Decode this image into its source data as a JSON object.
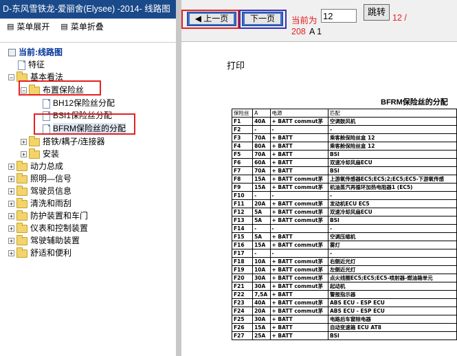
{
  "window": {
    "title": "D-东风雪铁龙-爱丽舍(Elysee)    -2014- 线路图"
  },
  "menu": {
    "expand": "菜单展开",
    "collapse": "菜单折叠"
  },
  "tree": {
    "current": "当前:线路图",
    "nodes": [
      {
        "label": "特征"
      },
      {
        "label": "基本看法"
      },
      {
        "label": "布置保险丝"
      },
      {
        "label": "BH12保险丝分配"
      },
      {
        "label": "BSI1保险丝分配"
      },
      {
        "label": "BFRM保险丝的分配"
      },
      {
        "label": "搭铁/耦子/连接器"
      },
      {
        "label": "安装"
      },
      {
        "label": "动力总成"
      },
      {
        "label": "照明—信号"
      },
      {
        "label": "驾驶员信息"
      },
      {
        "label": "清洗和雨刮"
      },
      {
        "label": "防护装置和车门"
      },
      {
        "label": "仪表和控制装置"
      },
      {
        "label": "驾驶辅助装置"
      },
      {
        "label": "舒适和便利"
      }
    ]
  },
  "nav": {
    "prev": "上一页",
    "next": "下一页",
    "current_label": "当前为",
    "page_value": "12",
    "jump": "跳转",
    "total_a": "12 /",
    "total_b": "208",
    "ab": "A 1",
    "accent": "#e32020"
  },
  "doc": {
    "print": "打印",
    "title": "BFRM保险丝的分配",
    "headers": [
      "保险丝",
      "A",
      "电源",
      "匹配"
    ],
    "rows": [
      [
        "F1",
        "40A",
        "+ BATT commut茅",
        "空调鼓风机"
      ],
      [
        "F2",
        "-",
        "-",
        "-"
      ],
      [
        "F3",
        "70A",
        "+ BATT",
        "乘客舱保险丝盒 12"
      ],
      [
        "F4",
        "80A",
        "+ BATT",
        "乘客舱保险丝盒 12"
      ],
      [
        "F5",
        "70A",
        "+ BATT",
        "BSI"
      ],
      [
        "F6",
        "60A",
        "+ BATT",
        "双速冷却风扇ECU"
      ],
      [
        "F7",
        "70A",
        "+ BATT",
        "BSI"
      ],
      [
        "F8",
        "15A",
        "+ BATT commut茅",
        "上游氧传感器EC5;EC5;2;EC5;EC5-下游氧传感"
      ],
      [
        "F9",
        "15A",
        "+ BATT commut茅",
        "机油蒸汽再循环加热电阻器1 (EC5)"
      ],
      [
        "F10",
        "-",
        "-",
        "-"
      ],
      [
        "F11",
        "20A",
        "+ BATT commut茅",
        "发动机ECU EC5"
      ],
      [
        "F12",
        "5A",
        "+ BATT commut茅",
        "双速冷却风扇ECU"
      ],
      [
        "F13",
        "5A",
        "+ BATT commut茅",
        "BSI"
      ],
      [
        "F14",
        "-",
        "-",
        "-"
      ],
      [
        "F15",
        "5A",
        "+ BATT",
        "空调压缩机"
      ],
      [
        "F16",
        "15A",
        "+ BATT commut茅",
        "雾灯"
      ],
      [
        "F17",
        "-",
        "-",
        "-"
      ],
      [
        "F18",
        "10A",
        "+ BATT commut茅",
        "右侧近光灯"
      ],
      [
        "F19",
        "10A",
        "+ BATT commut茅",
        "左侧近光灯"
      ],
      [
        "F20",
        "30A",
        "+ BATT commut茅",
        "点火线圈EC5;EC5;EC5-喷射器-燃油箱单元"
      ],
      [
        "F21",
        "30A",
        "+ BATT commut茅",
        "起动机"
      ],
      [
        "F22",
        "7,5A",
        "+ BATT",
        "警报指示器"
      ],
      [
        "F23",
        "40A",
        "+ BATT commut茅",
        "ABS ECU - ESP ECU"
      ],
      [
        "F24",
        "20A",
        "+ BATT commut茅",
        "ABS ECU - ESP ECU"
      ],
      [
        "F25",
        "30A",
        "+ BATT",
        "电路后车窗除电器"
      ],
      [
        "F26",
        "15A",
        "+ BATT",
        "自动变速箱 ECU AT8"
      ],
      [
        "F27",
        "25A",
        "+ BATT",
        "BSI"
      ]
    ]
  }
}
